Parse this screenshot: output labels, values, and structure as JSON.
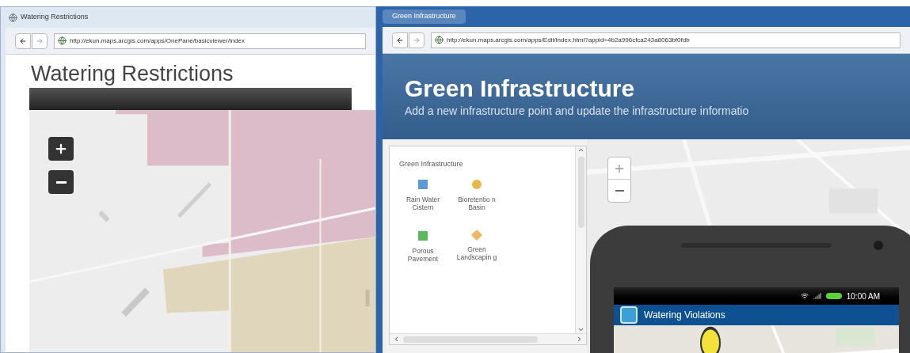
{
  "left_window": {
    "tab_title": "Watering Restrictions",
    "url": "http://ekun.maps.arcgis.com/apps/OnePane/basicviewer/index",
    "page_title": "Watering Restrictions"
  },
  "right_window": {
    "tab_title": "Green Infrastructure",
    "url": "http://ekun.maps.arcgis.com/apps/Edit/index.html?appid=4b2a996cfca243a8063bf0fdb",
    "page_title": "Green Infrastructure",
    "subtitle": "Add a new infrastructure point and update the infrastructure informatio",
    "templates": {
      "title": "Green Infrastructure",
      "items": [
        {
          "label": "Rain Water Cistern",
          "kind": "square",
          "color": "#5b9bd5"
        },
        {
          "label": "Bioretentio n Basin",
          "kind": "circle",
          "color": "#e8b84a"
        },
        {
          "label": "Porous Pavement",
          "kind": "square",
          "color": "#5cb85c"
        },
        {
          "label": "Green Landscapin g",
          "kind": "diamond",
          "color": "#f0b860"
        }
      ]
    }
  },
  "phone": {
    "time": "10:00 AM",
    "app_title": "Watering Violations"
  }
}
